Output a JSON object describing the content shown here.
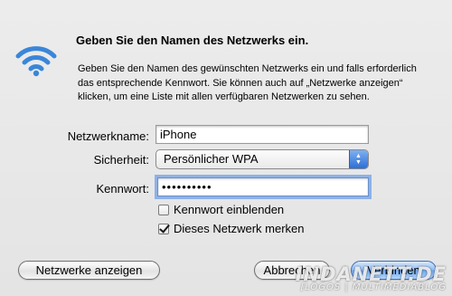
{
  "dialog": {
    "title": "Geben Sie den Namen des Netzwerks ein.",
    "description": "Geben Sie den Namen des gewünschten Netzwerks ein und falls erforderlich das entsprechende Kennwort. Sie können auch auf „Netzwerke anzeigen“ klicken, um eine Liste mit allen verfügbaren Netzwerken zu sehen.",
    "icon": "wifi-icon",
    "accent_color": "#3a86d9"
  },
  "form": {
    "network_name_label": "Netzwerkname:",
    "network_name_value": "iPhone",
    "security_label": "Sicherheit:",
    "security_value": "Persönlicher WPA",
    "password_label": "Kennwort:",
    "password_value": "••••••••••",
    "show_password_label": "Kennwort einblenden",
    "show_password_checked": false,
    "remember_network_label": "Dieses Netzwerk merken",
    "remember_network_checked": true
  },
  "buttons": {
    "show_networks": "Netzwerke anzeigen",
    "cancel": "Abbrechen",
    "connect": "Verbinden"
  },
  "watermark": {
    "main": "INDANETT.DE",
    "sub": "[LOGOS | MULTIMEDIABLOG"
  }
}
